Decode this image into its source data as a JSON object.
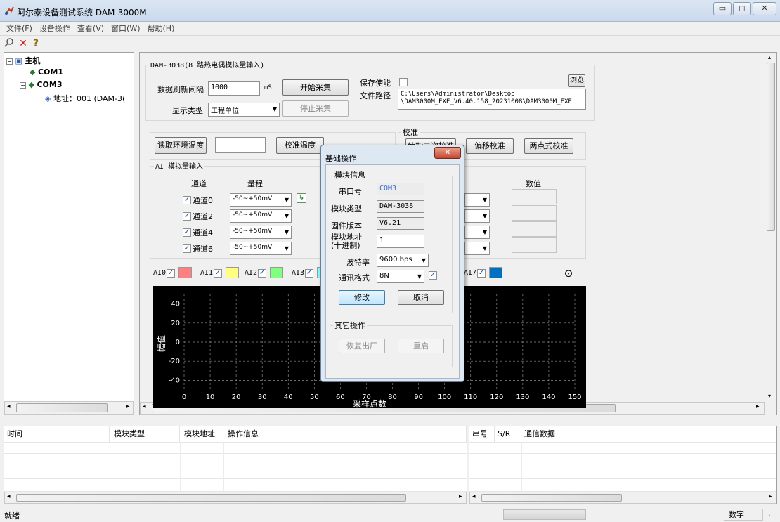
{
  "window": {
    "title": "阿尔泰设备测试系统 DAM-3000M",
    "minimize": "▭",
    "maximize": "◻",
    "close": "✕"
  },
  "menu": [
    "文件(F)",
    "设备操作",
    "查看(V)",
    "窗口(W)",
    "帮助(H)"
  ],
  "tree": {
    "root": "主机",
    "com1": "COM1",
    "com3": "COM3",
    "address": "地址：001 (DAM-3("
  },
  "panel": {
    "group_title": "DAM-3038(8 路热电偶模拟量输入)",
    "refresh_label": "数据刷新间隔",
    "refresh_value": "1000",
    "refresh_unit": "mS",
    "start_btn": "开始采集",
    "display_label": "显示类型",
    "display_value": "工程单位",
    "stop_btn": "停止采集",
    "save_enable_label": "保存使能",
    "browse_btn": "浏览",
    "path_label": "文件路径",
    "path_line1": "C:\\Users\\Administrator\\Desktop",
    "path_line2": "\\DAM3000M_EXE_V6.40.158_20231008\\DAM3000M_EXE",
    "read_temp_btn": "读取环境温度",
    "calib_temp_btn": "校准温度",
    "calib_group": "校准",
    "enable_secondary_btn": "使能二次校准",
    "offset_calib_btn": "偏移校准",
    "two_point_btn": "两点式校准"
  },
  "ai": {
    "title": "AI 模拟量输入",
    "col_channel": "通道",
    "col_range": "量程",
    "col_value": "数值",
    "rows": [
      {
        "channel": "通道0",
        "range": "-50~+50mV"
      },
      {
        "channel": "通道2",
        "range": "-50~+50mV"
      },
      {
        "channel": "通道4",
        "range": "-50~+50mV"
      },
      {
        "channel": "通道6",
        "range": "-50~+50mV"
      }
    ]
  },
  "legend": [
    {
      "label": "AI0",
      "color": "#ff8080"
    },
    {
      "label": "AI1",
      "color": "#ffff80"
    },
    {
      "label": "AI2",
      "color": "#80ff80"
    },
    {
      "label": "AI3",
      "color": "#80ffff"
    },
    {
      "label": "AI7",
      "color": "#0070c0"
    }
  ],
  "chart_data": {
    "type": "line",
    "ylabel": "幅值",
    "xlabel": "采样点数",
    "x_ticks": [
      "0",
      "10",
      "20",
      "30",
      "40",
      "50",
      "60",
      "70",
      "80",
      "90",
      "100",
      "110",
      "120",
      "130",
      "140",
      "150"
    ],
    "y_ticks": [
      "40",
      "20",
      "0",
      "-20",
      "-40"
    ],
    "xlim": [
      0,
      150
    ],
    "ylim": [
      -50,
      50
    ],
    "grid": true,
    "series": []
  },
  "dialog": {
    "title": "基础操作",
    "close": "✕",
    "info_group": "模块信息",
    "port_label": "串口号",
    "port_value": "COM3",
    "type_label": "模块类型",
    "type_value": "DAM-3038",
    "fw_label": "固件版本",
    "fw_value": "V6.21",
    "addr_label1": "模块地址",
    "addr_label2": "(十进制)",
    "addr_value": "1",
    "baud_label": "波特率",
    "baud_value": "9600 bps",
    "fmt_label": "通讯格式",
    "fmt_value": "8N",
    "modify_btn": "修改",
    "cancel_btn": "取消",
    "other_group": "其它操作",
    "restore_btn": "恢复出厂",
    "restart_btn": "重启"
  },
  "log": {
    "cols": [
      "时间",
      "模块类型",
      "模块地址",
      "操作信息"
    ]
  },
  "comm": {
    "cols": [
      "串号",
      "S/R",
      "通信数据"
    ]
  },
  "status": {
    "left": "就绪",
    "right": "数字"
  }
}
